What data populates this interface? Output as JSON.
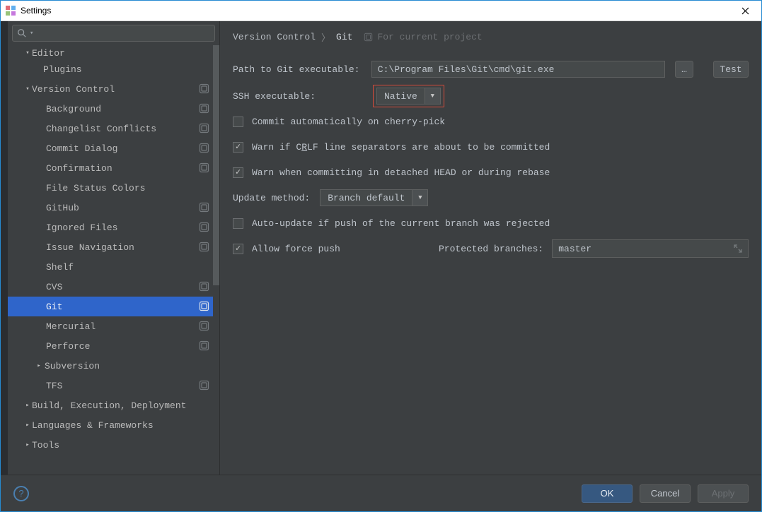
{
  "window": {
    "title": "Settings"
  },
  "search": {
    "placeholder": ""
  },
  "sidebar": {
    "editor": "Editor",
    "plugins": "Plugins",
    "version_control": "Version Control",
    "vc_items": [
      "Background",
      "Changelist Conflicts",
      "Commit Dialog",
      "Confirmation",
      "File Status Colors",
      "GitHub",
      "Ignored Files",
      "Issue Navigation",
      "Shelf",
      "CVS",
      "Git",
      "Mercurial",
      "Perforce",
      "Subversion",
      "TFS"
    ],
    "build": "Build, Execution, Deployment",
    "langs": "Languages & Frameworks",
    "tools": "Tools"
  },
  "breadcrumb": {
    "parent": "Version Control",
    "current": "Git",
    "tag": "For current project"
  },
  "form": {
    "path_label": "Path to Git executable:",
    "path_value": "C:\\Program Files\\Git\\cmd\\git.exe",
    "test_btn": "Test",
    "ellipsis_btn": "…",
    "ssh_label": "SSH executable:",
    "ssh_value": "Native",
    "cb_cherry": "Commit automatically on cherry-pick",
    "cb_crlf_pre": "Warn if C",
    "cb_crlf_u": "R",
    "cb_crlf_post": "LF line separators are about to be committed",
    "cb_detached": "Warn when committing in detached HEAD or during rebase",
    "update_label": "Update method:",
    "update_value": "Branch default",
    "cb_autoupdate": "Auto-update if push of the current branch was rejected",
    "cb_forcepush": "Allow force push",
    "protected_label": "Protected branches:",
    "protected_value": "master"
  },
  "footer": {
    "ok": "OK",
    "cancel": "Cancel",
    "apply": "Apply"
  }
}
